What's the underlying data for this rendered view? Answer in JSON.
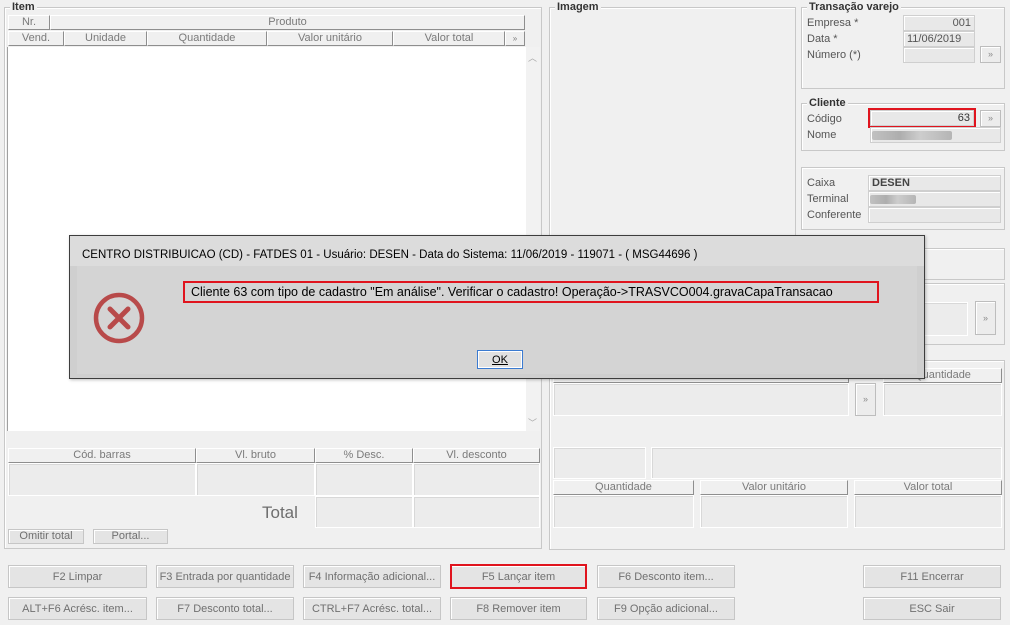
{
  "item": {
    "title": "Item",
    "headers_row1": [
      "Nr.",
      "Produto"
    ],
    "headers_row2": [
      "Vend.",
      "Unidade",
      "Quantidade",
      "Valor unitário",
      "Valor total"
    ],
    "sub_headers": [
      "Cód. barras",
      "Vl. bruto",
      "% Desc.",
      "Vl. desconto"
    ],
    "total_label": "Total",
    "omitir_label": "Omitir total",
    "portal_label": "Portal..."
  },
  "imagem": {
    "title": "Imagem"
  },
  "transacao": {
    "title": "Transação varejo",
    "empresa_label": "Empresa *",
    "empresa_value": "001",
    "data_label": "Data *",
    "data_value": "11/06/2019",
    "numero_label": "Número (*)",
    "numero_value": ""
  },
  "cliente": {
    "title": "Cliente",
    "codigo_label": "Código",
    "codigo_value": "63",
    "nome_label": "Nome"
  },
  "caixa": {
    "caixa_label": "Caixa",
    "caixa_value": "DESEN",
    "terminal_label": "Terminal",
    "conferente_label": "Conferente",
    "conferente_value": ""
  },
  "right_headers": {
    "quantidade_top": "Quantidade",
    "quantidade": "Quantidade",
    "valor_unitario": "Valor unitário",
    "valor_total": "Valor total"
  },
  "buttons": {
    "row1": [
      "F2 Limpar",
      "F3 Entrada por quantidade",
      "F4 Informação adicional...",
      "F5 Lançar item",
      "F6 Desconto item...",
      "F11 Encerrar"
    ],
    "row2": [
      "ALT+F6 Acrésc. item...",
      "F7 Desconto total...",
      "CTRL+F7 Acrésc. total...",
      "F8 Remover item",
      "F9 Opção adicional...",
      "ESC Sair"
    ]
  },
  "dialog": {
    "title": "CENTRO DISTRIBUICAO (CD) - FATDES 01 - Usuário: DESEN - Data do Sistema: 11/06/2019 - 119071 - ( MSG44696 )",
    "message": "Cliente 63 com tipo de cadastro \"Em análise\". Verificar o cadastro! Operação->TRASVCO004.gravaCapaTransacao",
    "ok_label": "OK",
    "icon": "error-icon"
  },
  "colors": {
    "highlight": "#e0141e",
    "error_icon": "#b84a4a"
  }
}
